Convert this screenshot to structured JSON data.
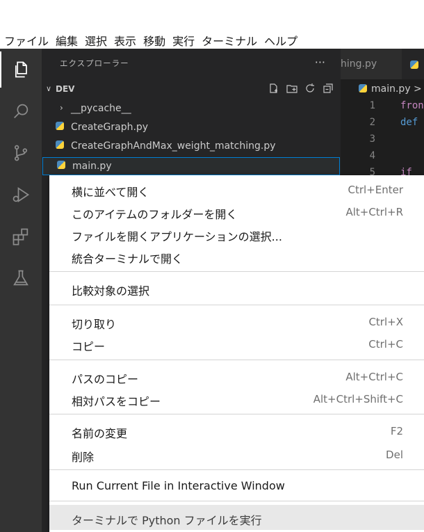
{
  "menubar": {
    "items": [
      "ファイル",
      "編集",
      "選択",
      "表示",
      "移動",
      "実行",
      "ターミナル",
      "ヘルプ"
    ]
  },
  "activity_bar": {
    "icons": [
      "explorer-icon",
      "search-icon",
      "source-control-icon",
      "run-debug-icon",
      "extensions-icon",
      "testing-icon"
    ]
  },
  "sidebar": {
    "title": "エクスプローラー",
    "more": "···",
    "section": "DEV",
    "files": [
      {
        "label": "__pycache__",
        "type": "folder"
      },
      {
        "label": "CreateGraph.py",
        "type": "python"
      },
      {
        "label": "CreateGraphAndMax_weight_matching.py",
        "type": "python"
      },
      {
        "label": "main.py",
        "type": "python",
        "selected": true
      }
    ]
  },
  "editor": {
    "tab1": "hing.py",
    "breadcrumb": "main.py >",
    "lines": [
      "1",
      "2",
      "3",
      "4",
      "5"
    ],
    "code": [
      "fron",
      "def",
      "",
      "",
      "if"
    ]
  },
  "context_menu": {
    "items": [
      {
        "label": "横に並べて開く",
        "shortcut": "Ctrl+Enter"
      },
      {
        "label": "このアイテムのフォルダーを開く",
        "shortcut": "Alt+Ctrl+R"
      },
      {
        "label": "ファイルを開くアプリケーションの選択...",
        "shortcut": ""
      },
      {
        "label": "統合ターミナルで開く",
        "shortcut": ""
      },
      {
        "label": "比較対象の選択",
        "shortcut": ""
      },
      {
        "label": "切り取り",
        "shortcut": "Ctrl+X"
      },
      {
        "label": "コピー",
        "shortcut": "Ctrl+C"
      },
      {
        "label": "パスのコピー",
        "shortcut": "Alt+Ctrl+C"
      },
      {
        "label": "相対パスをコピー",
        "shortcut": "Alt+Ctrl+Shift+C"
      },
      {
        "label": "名前の変更",
        "shortcut": "F2"
      },
      {
        "label": "削除",
        "shortcut": "Del"
      },
      {
        "label": "Run Current File in Interactive Window",
        "shortcut": ""
      },
      {
        "label": "ターミナルで Python ファイルを実行",
        "shortcut": ""
      }
    ]
  },
  "colors": {
    "activity_bar": "#333333",
    "sidebar": "#252526",
    "editor": "#1e1e1e",
    "selection_border": "#007fd4",
    "menu_hover": "#e8e8e8"
  }
}
